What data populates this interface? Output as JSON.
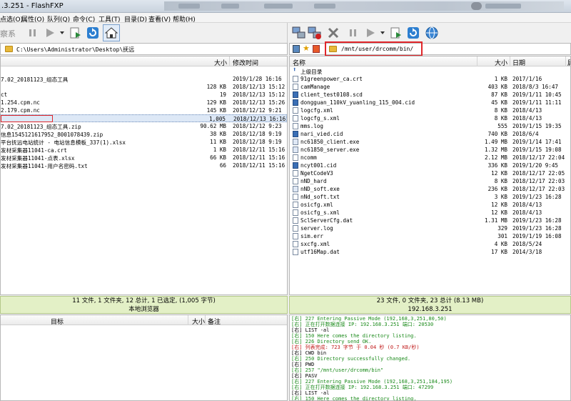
{
  "window": {
    "title": ".3.251 - FlashFXP"
  },
  "menu": [
    "点选(O)",
    "属性(O)",
    "队列(Q)",
    "命令(C)",
    "工具(T)",
    "目录(D)",
    "查看(V)",
    "帮助(H)"
  ],
  "toolbar_left": {
    "label": "察系"
  },
  "local": {
    "path": "C:\\Users\\Administrator\\Desktop\\抚远",
    "columns": {
      "size": "大小",
      "modified": "修改时间"
    },
    "files": [
      {
        "name": "7.02_20181123_组态工具",
        "size": "",
        "date": "2019/1/28 16:16"
      },
      {
        "name": "",
        "size": "128 KB",
        "date": "2018/12/13 15:12"
      },
      {
        "name": "ct",
        "size": "19",
        "date": "2018/12/13 15:12"
      },
      {
        "name": "1.254.cpm.nc",
        "size": "129 KB",
        "date": "2018/12/13 15:26"
      },
      {
        "name": "2.179.cpm.nc",
        "size": "145 KB",
        "date": "2018/12/12 9:21"
      },
      {
        "name": "",
        "size": "1,005",
        "date": "2018/12/13 16:16"
      },
      {
        "name": "7.02_20181123_组态工具.zip",
        "size": "90.62 MB",
        "date": "2018/12/12 9:23"
      },
      {
        "name": "信息1545121617952_8001078439.zip",
        "size": "38 KB",
        "date": "2018/12/18 9:19"
      },
      {
        "name": "平台抚远电站统计 - 电站信息模板_337(1).xlsx",
        "size": "11 KB",
        "date": "2018/12/18 9:19"
      },
      {
        "name": "发材采集器11041-ca.crt",
        "size": "1 KB",
        "date": "2018/12/11 15:16"
      },
      {
        "name": "发材采集器11041-点表.xlsx",
        "size": "66 KB",
        "date": "2018/12/11 15:16"
      },
      {
        "name": "发材采集器11041-用户名密码.txt",
        "size": "66",
        "date": "2018/12/11 15:16"
      }
    ],
    "status_line1": "11 文件, 1 文件夹, 12 总计, 1 已选定, (1,005 字节)",
    "status_line2": "本地浏览器"
  },
  "remote": {
    "path": "/mnt/user/drcomm/bin/",
    "columns": {
      "name": "名称",
      "size": "大小",
      "date": "日期",
      "extra": "属"
    },
    "parent_label": "上级目录",
    "files": [
      {
        "name": "91greenpower_ca.crt",
        "size": "1 KB",
        "date": "2017/1/16",
        "icon": "file"
      },
      {
        "name": "camManage",
        "size": "403 KB",
        "date": "2018/8/3 16:47",
        "icon": "file"
      },
      {
        "name": "client_test0108.scd",
        "size": "87 KB",
        "date": "2019/1/11 10:45",
        "icon": "app"
      },
      {
        "name": "dongguan_110kV_yuanling_115_004.cid",
        "size": "45 KB",
        "date": "2019/1/11 11:11",
        "icon": "app"
      },
      {
        "name": "logcfg.xml",
        "size": "8 KB",
        "date": "2018/4/13",
        "icon": "file"
      },
      {
        "name": "logcfg_s.xml",
        "size": "8 KB",
        "date": "2018/4/13",
        "icon": "file"
      },
      {
        "name": "mms.log",
        "size": "555",
        "date": "2019/1/15 19:35",
        "icon": "file"
      },
      {
        "name": "nari_vied.cid",
        "size": "740 KB",
        "date": "2018/6/4",
        "icon": "app"
      },
      {
        "name": "nc61850_client.exe",
        "size": "1.49 MB",
        "date": "2019/1/14 17:41",
        "icon": "exe"
      },
      {
        "name": "nc61850_server.exe",
        "size": "1.32 MB",
        "date": "2019/1/15 19:08",
        "icon": "exe"
      },
      {
        "name": "ncomm",
        "size": "2.12 MB",
        "date": "2018/12/17 22:04",
        "icon": "file"
      },
      {
        "name": "ncyt001.cid",
        "size": "336 KB",
        "date": "2019/1/20 9:45",
        "icon": "app"
      },
      {
        "name": "NgetCodeV3",
        "size": "12 KB",
        "date": "2018/12/17 22:05",
        "icon": "file"
      },
      {
        "name": "nND_hard",
        "size": "8 KB",
        "date": "2018/12/17 22:03",
        "icon": "file"
      },
      {
        "name": "nND_soft.exe",
        "size": "236 KB",
        "date": "2018/12/17 22:03",
        "icon": "exe"
      },
      {
        "name": "nNd_soft.txt",
        "size": "3 KB",
        "date": "2019/1/23 16:28",
        "icon": "file"
      },
      {
        "name": "osicfg.xml",
        "size": "12 KB",
        "date": "2018/4/13",
        "icon": "file"
      },
      {
        "name": "osicfg_s.xml",
        "size": "12 KB",
        "date": "2018/4/13",
        "icon": "file"
      },
      {
        "name": "SclServerCfg.dat",
        "size": "1.31 MB",
        "date": "2019/1/23 16:28",
        "icon": "file"
      },
      {
        "name": "server.log",
        "size": "329",
        "date": "2019/1/23 16:28",
        "icon": "file"
      },
      {
        "name": "sim.err",
        "size": "301",
        "date": "2019/1/19 16:08",
        "icon": "file"
      },
      {
        "name": "sxcfg.xml",
        "size": "4 KB",
        "date": "2018/5/24",
        "icon": "file"
      },
      {
        "name": "utf16Map.dat",
        "size": "17 KB",
        "date": "2014/3/18",
        "icon": "file"
      }
    ],
    "status_line1": "23 文件, 0 文件夹, 23 总计 (8.13 MB)",
    "status_line2": "192.168.3.251"
  },
  "queue": {
    "columns": {
      "target": "目标",
      "size": "大小",
      "note": "备注"
    }
  },
  "log": [
    {
      "text": "[右] 227 Entering Passive Mode (192,168,3,251,80,50)",
      "color": "green"
    },
    {
      "text": "[右] 正在打开数据连接 IP: 192.168.3.251 端口: 20530",
      "color": "green"
    },
    {
      "text": "[右] LIST -al",
      "color": "black"
    },
    {
      "text": "[右] 150 Here comes the directory listing.",
      "color": "green"
    },
    {
      "text": "[右] 226 Directory send OK.",
      "color": "green"
    },
    {
      "text": "[右] 列表完成: 723 字节 于 0.04 秒 (0.7 KB/秒)",
      "color": "red"
    },
    {
      "text": "[右] CWD bin",
      "color": "black"
    },
    {
      "text": "[右] 250 Directory successfully changed.",
      "color": "green"
    },
    {
      "text": "[右] PWD",
      "color": "black"
    },
    {
      "text": "[右] 257 \"/mnt/user/drcomm/bin\"",
      "color": "green"
    },
    {
      "text": "[右] PASV",
      "color": "black"
    },
    {
      "text": "[右] 227 Entering Passive Mode (192,168,3,251,184,195)",
      "color": "green"
    },
    {
      "text": "[右] 正在打开数据连接 IP: 192.168.3.251 端口: 47299",
      "color": "green"
    },
    {
      "text": "[右] LIST -al",
      "color": "black"
    },
    {
      "text": "[右] 150 Here comes the directory listing.",
      "color": "green"
    }
  ]
}
